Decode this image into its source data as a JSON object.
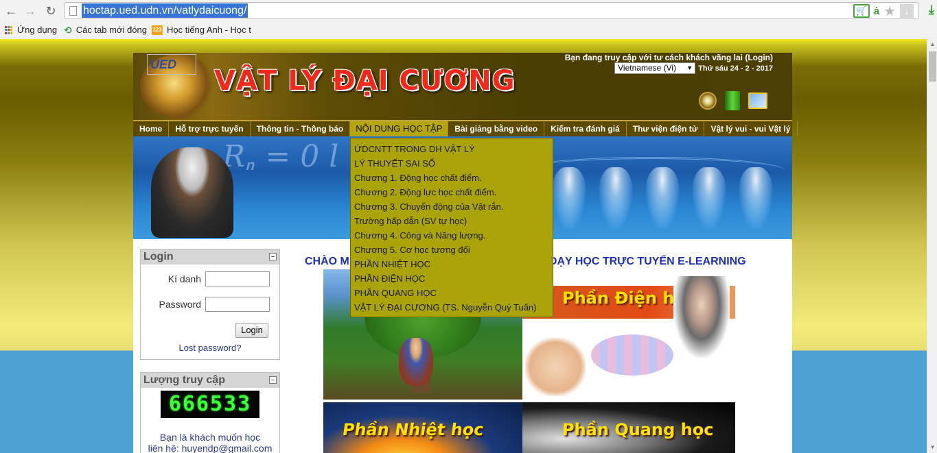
{
  "browser": {
    "url": "hoctap.ued.udn.vn/vatlydaicuong/",
    "bookmarks": [
      {
        "label": "Ứng dụng"
      },
      {
        "label": "Các tab mới đóng"
      },
      {
        "label": "Học tiếng Anh - Học t"
      }
    ]
  },
  "header": {
    "logo_alt": "UED",
    "title": "VẬT LÝ ĐẠI CƯƠNG",
    "login_status": "Bạn đang truy cập với tư cách khách vãng lai (Login)",
    "language": "Vietnamese (Vi)",
    "date": "Thứ sáu 24 - 2 - 2017"
  },
  "menu": [
    "Home",
    "Hỗ trợ trực tuyến",
    "Thông tin - Thông báo",
    "NỘI DUNG HỌC TẬP",
    "Bài giảng bằng video",
    "Kiểm tra đánh giá",
    "Thư viện điện tử",
    "Vật lý vui - vui Vật lý"
  ],
  "dropdown": [
    "ỨDCNTT TRONG DH VẬT LÝ",
    "LÝ THUYẾT SAI SỐ",
    "Chương 1. Động học chất điểm.",
    "Chương 2. Động lực học chất điểm.",
    "Chương 3. Chuyển động của Vật rắn.",
    "Trường hấp dẫn (SV tự học)",
    "Chương 4. Công và Năng lượng.",
    "Chương 5. Cơ học tương đối",
    "PHẦN NHIỆT HỌC",
    "PHẦN ĐIỆN HỌC",
    "PHẦN QUANG HỌC",
    "VẬT LÝ ĐẠI CƯƠNG (TS. Nguyễn Quý Tuấn)"
  ],
  "login_block": {
    "title": "Login",
    "username_label": "Kí danh",
    "password_label": "Password",
    "login_button": "Login",
    "lost_password": "Lost password?"
  },
  "visits_block": {
    "title": "Lượng truy cập",
    "counter": "666533",
    "text_line1": "Bạn là khách muốn học",
    "text_line2": "liên hệ: huyendp@gmail.com"
  },
  "main": {
    "welcome_left": "CHÀO M",
    "welcome_right": "DẠY HỌC TRỰC TUYẾN E-LEARNING",
    "tile_dien": "Phần Điện học",
    "tile_nhiet": "Phần Nhiệt học",
    "tile_quang": "Phần Quang học"
  }
}
